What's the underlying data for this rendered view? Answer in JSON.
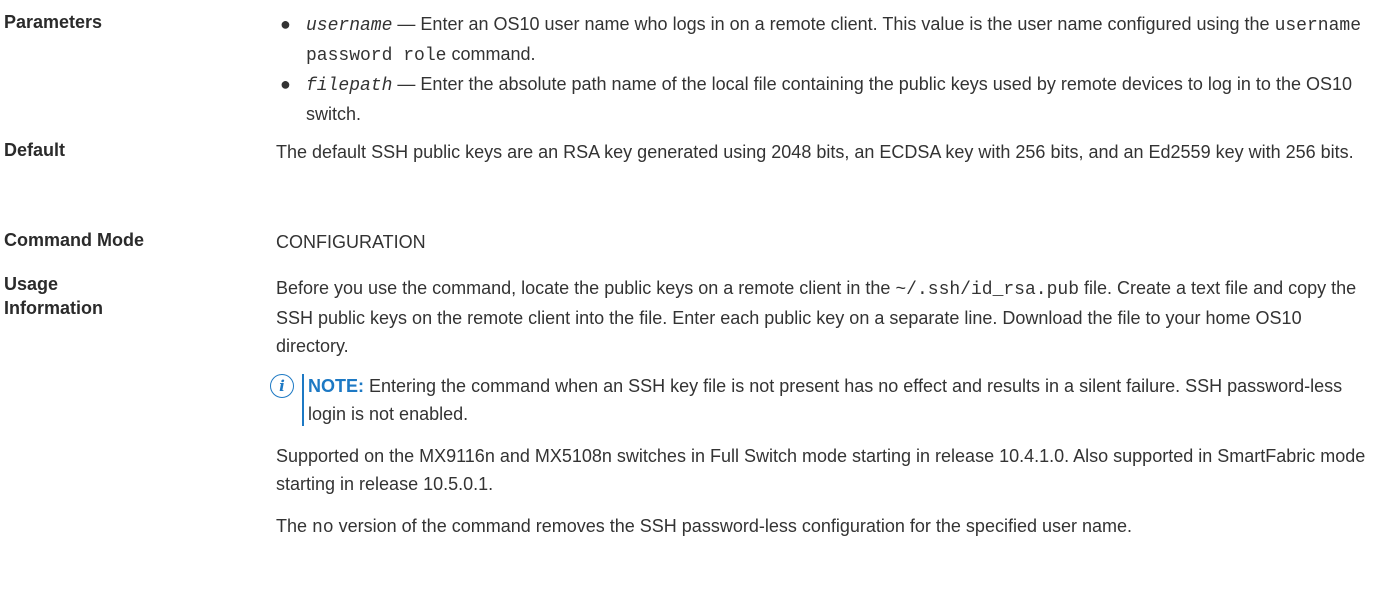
{
  "parameters": {
    "term": "Parameters",
    "items": [
      {
        "name": "username",
        "desc_a": " — Enter an OS10 user name who logs in on a remote client. This value is the user name configured using the ",
        "code": "username password role",
        "desc_b": " command."
      },
      {
        "name": "filepath",
        "desc_a": " — Enter the absolute path name of the local file containing the public keys used by remote devices to log in to the OS10 switch."
      }
    ]
  },
  "default": {
    "term": "Default",
    "text": "The default SSH public keys are an RSA key generated using 2048 bits, an ECDSA key with 256 bits, and an Ed2559 key with 256 bits."
  },
  "command_mode": {
    "term": "Command Mode",
    "text": "CONFIGURATION"
  },
  "usage": {
    "term_line1": "Usage",
    "term_line2": "Information",
    "p1_a": "Before you use the command, locate the public keys on a remote client in the ",
    "p1_code": "~/.ssh/id_rsa.pub",
    "p1_b": " file. Create a text file and copy the SSH public keys on the remote client into the file. Enter each public key on a separate line. Download the file to your home OS10 directory.",
    "note_label": "NOTE:",
    "note_text": " Entering the command when an SSH key file is not present has no effect and results in a silent failure. SSH password-less login is not enabled.",
    "p2": "Supported on the MX9116n and MX5108n switches in Full Switch mode starting in release 10.4.1.0. Also supported in SmartFabric mode starting in release 10.5.0.1.",
    "p3_a": "The ",
    "p3_code": "no",
    "p3_b": " version of the command removes the SSH password-less configuration for the specified user name."
  }
}
